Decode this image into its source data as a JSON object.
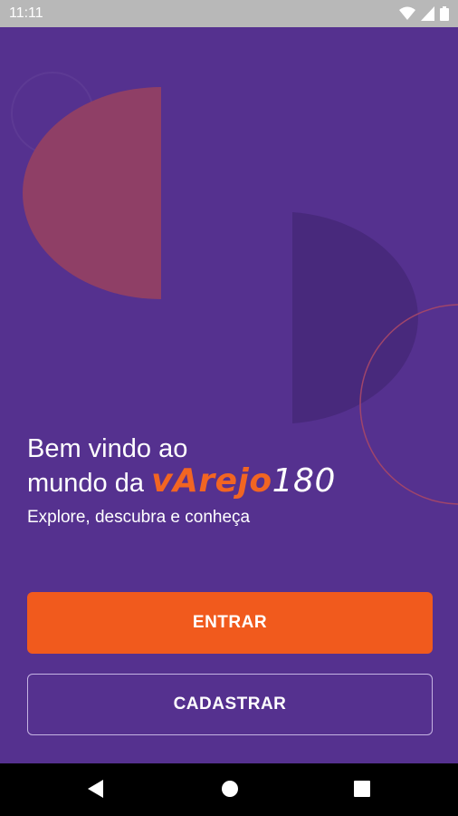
{
  "status_bar": {
    "time": "11:11",
    "icons": [
      "wifi-icon",
      "signal-icon",
      "battery-icon"
    ]
  },
  "welcome": {
    "line1": "Bem vindo ao",
    "line2_prefix": "mundo da",
    "brand_word": "vArejo",
    "brand_number": "180"
  },
  "subtitle": "Explore, descubra e conheça",
  "buttons": {
    "entrar": "ENTRAR",
    "cadastrar": "CADASTRAR"
  },
  "nav_bar": {
    "icons": [
      "back-icon",
      "home-icon",
      "recents-icon"
    ]
  },
  "colors": {
    "background": "#55318f",
    "accent": "#f15a1d",
    "brand": "#f26522",
    "deco_red": "#8f3f66",
    "deco_dark": "#48297c"
  }
}
